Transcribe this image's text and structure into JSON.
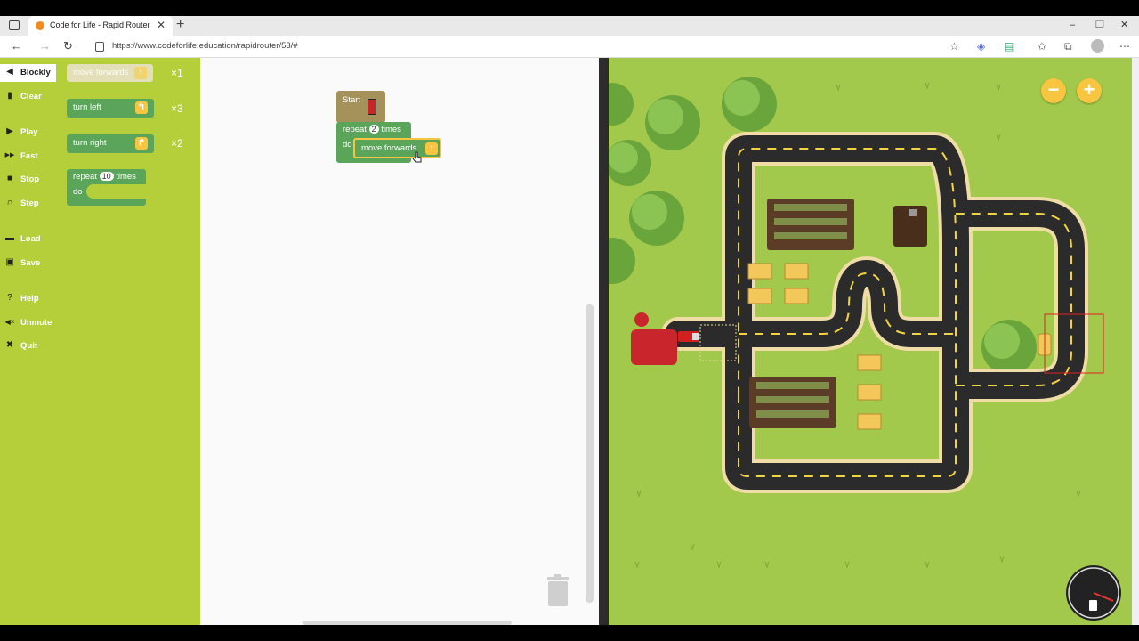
{
  "browser": {
    "tab_title": "Code for Life - Rapid Router",
    "tab_close": "✕",
    "new_tab": "+",
    "url": "https://www.codeforlife.education/rapidrouter/53/#",
    "window_controls": {
      "minimize": "–",
      "restore": "❐",
      "close": "✕"
    }
  },
  "left_nav": {
    "items": [
      {
        "label": "Blockly",
        "icon": "blockly-icon",
        "glyph": "◀"
      },
      {
        "label": "Clear",
        "icon": "trash-icon",
        "glyph": "▮"
      },
      {
        "label": "Play",
        "icon": "play-icon",
        "glyph": "▶"
      },
      {
        "label": "Fast",
        "icon": "fast-forward-icon",
        "glyph": "▶▶"
      },
      {
        "label": "Stop",
        "icon": "stop-icon",
        "glyph": "■"
      },
      {
        "label": "Step",
        "icon": "step-icon",
        "glyph": "∩"
      },
      {
        "label": "Load",
        "icon": "folder-icon",
        "glyph": "▬"
      },
      {
        "label": "Save",
        "icon": "save-icon",
        "glyph": "▣"
      },
      {
        "label": "Help",
        "icon": "help-icon",
        "glyph": "?"
      },
      {
        "label": "Unmute",
        "icon": "speaker-muted-icon",
        "glyph": "◀×"
      },
      {
        "label": "Quit",
        "icon": "quit-icon",
        "glyph": "✖"
      }
    ]
  },
  "toolbox": {
    "move_forwards": {
      "label": "move forwards",
      "count": "×1"
    },
    "turn_left": {
      "label": "turn left",
      "count": "×3"
    },
    "turn_right": {
      "label": "turn right",
      "count": "×2"
    },
    "repeat": {
      "label_a": "repeat",
      "value": "10",
      "label_b": "times",
      "do": "do"
    }
  },
  "workspace": {
    "start": {
      "label": "Start"
    },
    "repeat": {
      "label_a": "repeat",
      "value": "2",
      "label_b": "times",
      "do": "do"
    },
    "move_forwards": {
      "label": "move forwards"
    }
  },
  "map": {
    "zoom_out": "−",
    "zoom_in": "+"
  },
  "colors": {
    "sidebar_green": "#b4cf39",
    "block_green": "#5ba55b",
    "start_block": "#a5925b",
    "arrow_yellow": "#f7c540",
    "grass": "#a2c94b",
    "road": "#2b2b2b",
    "road_dash": "#f3d341",
    "road_edge": "#f0dda6"
  }
}
